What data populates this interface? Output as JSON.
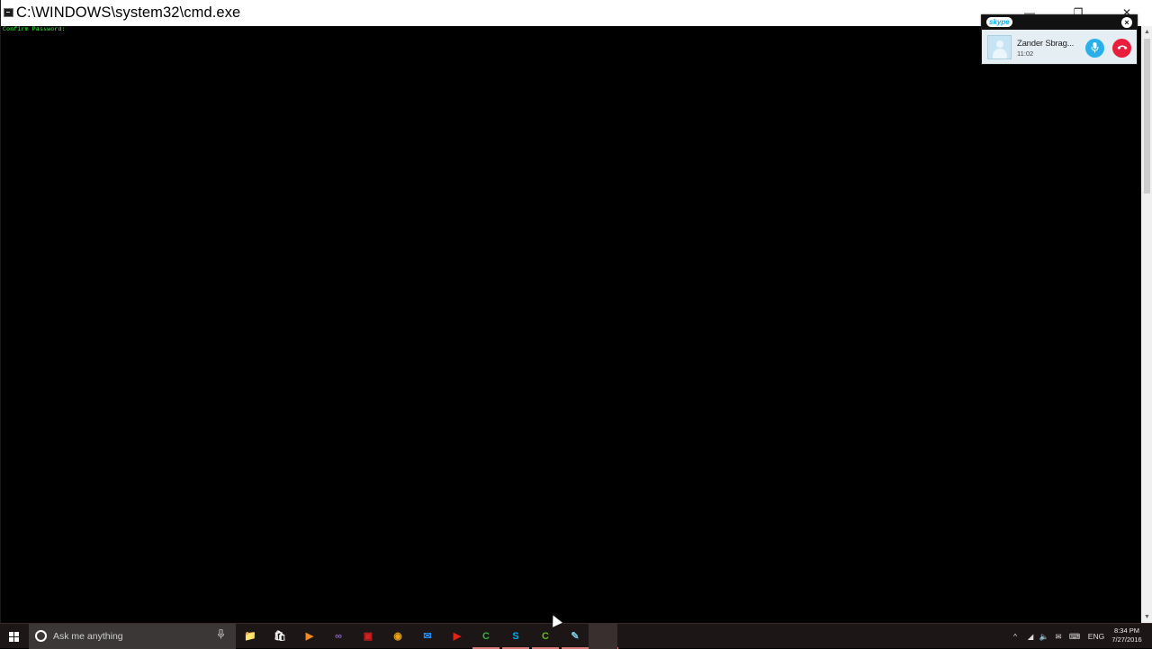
{
  "window": {
    "title": "C:\\WINDOWS\\system32\\cmd.exe",
    "icon": "cmd-icon",
    "controls": {
      "minimize": "—",
      "restore": "❐",
      "close": "✕"
    }
  },
  "console": {
    "lines": [
      "Confirm Password:"
    ],
    "text_color": "#35ff35",
    "background": "#000000"
  },
  "skype_call": {
    "brand": "skype",
    "close_label": "×",
    "contact_name": "Zander Sbrag...",
    "duration": "11:02",
    "mic_icon": "microphone-icon",
    "hangup_icon": "phone-hangup-icon",
    "mic_glyph": "⏺",
    "hangup_glyph": "☎"
  },
  "taskbar": {
    "search_placeholder": "Ask me anything",
    "apps": [
      {
        "name": "file-explorer",
        "glyph": "📁",
        "color": "#f0c040"
      },
      {
        "name": "store",
        "glyph": "🛍",
        "color": "#ffffff"
      },
      {
        "name": "media-player",
        "glyph": "▶",
        "color": "#f08a24"
      },
      {
        "name": "visual-studio",
        "glyph": "∞",
        "color": "#8661c5"
      },
      {
        "name": "red-app",
        "glyph": "▣",
        "color": "#d62020"
      },
      {
        "name": "chrome",
        "glyph": "◉",
        "color": "#e8a317"
      },
      {
        "name": "mail",
        "glyph": "✉",
        "color": "#1e90ff"
      },
      {
        "name": "youtube",
        "glyph": "▶",
        "color": "#e62117"
      },
      {
        "name": "camtasia",
        "glyph": "C",
        "color": "#3cb043"
      },
      {
        "name": "skype",
        "glyph": "S",
        "color": "#00aff0"
      },
      {
        "name": "camtasia-recorder",
        "glyph": "C",
        "color": "#5fba2d"
      },
      {
        "name": "notepad",
        "glyph": "✎",
        "color": "#7ec8e3"
      },
      {
        "name": "command-prompt",
        "glyph": ">_",
        "color": "#cccccc"
      }
    ],
    "tray": {
      "chevron": "^",
      "network": "◢",
      "volume": "🔈",
      "notifications": "✉",
      "keyboard": "⌨",
      "language": "ENG"
    },
    "time": "8:34 PM",
    "date": "7/27/2016"
  }
}
